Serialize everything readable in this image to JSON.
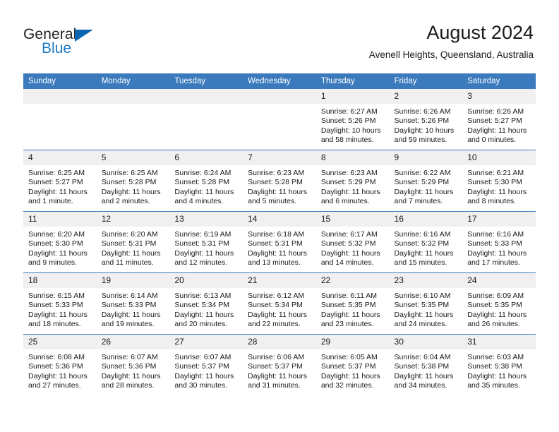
{
  "brand": {
    "name_top": "General",
    "name_bottom": "Blue",
    "triangle_color": "#0a66b0",
    "blue_color": "#1f7ac4"
  },
  "header": {
    "title": "August 2024",
    "subtitle": "Avenell Heights, Queensland, Australia"
  },
  "theme": {
    "header_blue": "#3a7abd",
    "daynum_bg": "#f0f0f0"
  },
  "weekdays": [
    "Sunday",
    "Monday",
    "Tuesday",
    "Wednesday",
    "Thursday",
    "Friday",
    "Saturday"
  ],
  "labels": {
    "sunrise": "Sunrise:",
    "sunset": "Sunset:",
    "daylight": "Daylight:"
  },
  "weeks": [
    [
      {
        "day": "",
        "empty": true
      },
      {
        "day": "",
        "empty": true
      },
      {
        "day": "",
        "empty": true
      },
      {
        "day": "",
        "empty": true
      },
      {
        "day": "1",
        "sunrise": "Sunrise: 6:27 AM",
        "sunset": "Sunset: 5:26 PM",
        "daylight": "Daylight: 10 hours and 58 minutes."
      },
      {
        "day": "2",
        "sunrise": "Sunrise: 6:26 AM",
        "sunset": "Sunset: 5:26 PM",
        "daylight": "Daylight: 10 hours and 59 minutes."
      },
      {
        "day": "3",
        "sunrise": "Sunrise: 6:26 AM",
        "sunset": "Sunset: 5:27 PM",
        "daylight": "Daylight: 11 hours and 0 minutes."
      }
    ],
    [
      {
        "day": "4",
        "sunrise": "Sunrise: 6:25 AM",
        "sunset": "Sunset: 5:27 PM",
        "daylight": "Daylight: 11 hours and 1 minute."
      },
      {
        "day": "5",
        "sunrise": "Sunrise: 6:25 AM",
        "sunset": "Sunset: 5:28 PM",
        "daylight": "Daylight: 11 hours and 2 minutes."
      },
      {
        "day": "6",
        "sunrise": "Sunrise: 6:24 AM",
        "sunset": "Sunset: 5:28 PM",
        "daylight": "Daylight: 11 hours and 4 minutes."
      },
      {
        "day": "7",
        "sunrise": "Sunrise: 6:23 AM",
        "sunset": "Sunset: 5:28 PM",
        "daylight": "Daylight: 11 hours and 5 minutes."
      },
      {
        "day": "8",
        "sunrise": "Sunrise: 6:23 AM",
        "sunset": "Sunset: 5:29 PM",
        "daylight": "Daylight: 11 hours and 6 minutes."
      },
      {
        "day": "9",
        "sunrise": "Sunrise: 6:22 AM",
        "sunset": "Sunset: 5:29 PM",
        "daylight": "Daylight: 11 hours and 7 minutes."
      },
      {
        "day": "10",
        "sunrise": "Sunrise: 6:21 AM",
        "sunset": "Sunset: 5:30 PM",
        "daylight": "Daylight: 11 hours and 8 minutes."
      }
    ],
    [
      {
        "day": "11",
        "sunrise": "Sunrise: 6:20 AM",
        "sunset": "Sunset: 5:30 PM",
        "daylight": "Daylight: 11 hours and 9 minutes."
      },
      {
        "day": "12",
        "sunrise": "Sunrise: 6:20 AM",
        "sunset": "Sunset: 5:31 PM",
        "daylight": "Daylight: 11 hours and 11 minutes."
      },
      {
        "day": "13",
        "sunrise": "Sunrise: 6:19 AM",
        "sunset": "Sunset: 5:31 PM",
        "daylight": "Daylight: 11 hours and 12 minutes."
      },
      {
        "day": "14",
        "sunrise": "Sunrise: 6:18 AM",
        "sunset": "Sunset: 5:31 PM",
        "daylight": "Daylight: 11 hours and 13 minutes."
      },
      {
        "day": "15",
        "sunrise": "Sunrise: 6:17 AM",
        "sunset": "Sunset: 5:32 PM",
        "daylight": "Daylight: 11 hours and 14 minutes."
      },
      {
        "day": "16",
        "sunrise": "Sunrise: 6:16 AM",
        "sunset": "Sunset: 5:32 PM",
        "daylight": "Daylight: 11 hours and 15 minutes."
      },
      {
        "day": "17",
        "sunrise": "Sunrise: 6:16 AM",
        "sunset": "Sunset: 5:33 PM",
        "daylight": "Daylight: 11 hours and 17 minutes."
      }
    ],
    [
      {
        "day": "18",
        "sunrise": "Sunrise: 6:15 AM",
        "sunset": "Sunset: 5:33 PM",
        "daylight": "Daylight: 11 hours and 18 minutes."
      },
      {
        "day": "19",
        "sunrise": "Sunrise: 6:14 AM",
        "sunset": "Sunset: 5:33 PM",
        "daylight": "Daylight: 11 hours and 19 minutes."
      },
      {
        "day": "20",
        "sunrise": "Sunrise: 6:13 AM",
        "sunset": "Sunset: 5:34 PM",
        "daylight": "Daylight: 11 hours and 20 minutes."
      },
      {
        "day": "21",
        "sunrise": "Sunrise: 6:12 AM",
        "sunset": "Sunset: 5:34 PM",
        "daylight": "Daylight: 11 hours and 22 minutes."
      },
      {
        "day": "22",
        "sunrise": "Sunrise: 6:11 AM",
        "sunset": "Sunset: 5:35 PM",
        "daylight": "Daylight: 11 hours and 23 minutes."
      },
      {
        "day": "23",
        "sunrise": "Sunrise: 6:10 AM",
        "sunset": "Sunset: 5:35 PM",
        "daylight": "Daylight: 11 hours and 24 minutes."
      },
      {
        "day": "24",
        "sunrise": "Sunrise: 6:09 AM",
        "sunset": "Sunset: 5:35 PM",
        "daylight": "Daylight: 11 hours and 26 minutes."
      }
    ],
    [
      {
        "day": "25",
        "sunrise": "Sunrise: 6:08 AM",
        "sunset": "Sunset: 5:36 PM",
        "daylight": "Daylight: 11 hours and 27 minutes."
      },
      {
        "day": "26",
        "sunrise": "Sunrise: 6:07 AM",
        "sunset": "Sunset: 5:36 PM",
        "daylight": "Daylight: 11 hours and 28 minutes."
      },
      {
        "day": "27",
        "sunrise": "Sunrise: 6:07 AM",
        "sunset": "Sunset: 5:37 PM",
        "daylight": "Daylight: 11 hours and 30 minutes."
      },
      {
        "day": "28",
        "sunrise": "Sunrise: 6:06 AM",
        "sunset": "Sunset: 5:37 PM",
        "daylight": "Daylight: 11 hours and 31 minutes."
      },
      {
        "day": "29",
        "sunrise": "Sunrise: 6:05 AM",
        "sunset": "Sunset: 5:37 PM",
        "daylight": "Daylight: 11 hours and 32 minutes."
      },
      {
        "day": "30",
        "sunrise": "Sunrise: 6:04 AM",
        "sunset": "Sunset: 5:38 PM",
        "daylight": "Daylight: 11 hours and 34 minutes."
      },
      {
        "day": "31",
        "sunrise": "Sunrise: 6:03 AM",
        "sunset": "Sunset: 5:38 PM",
        "daylight": "Daylight: 11 hours and 35 minutes."
      }
    ]
  ]
}
